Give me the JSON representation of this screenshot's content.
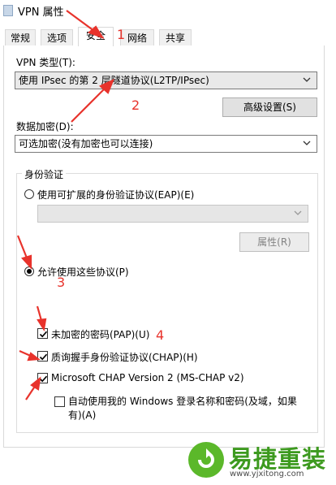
{
  "window": {
    "title": "VPN 属性"
  },
  "tabs": [
    {
      "label": "常规"
    },
    {
      "label": "选项"
    },
    {
      "label": "安全"
    },
    {
      "label": "网络"
    },
    {
      "label": "共享"
    }
  ],
  "vpn_type": {
    "label": "VPN 类型(T):",
    "value": "使用 IPsec 的第 2 层隧道协议(L2TP/IPsec)"
  },
  "advanced_button": "高级设置(S)",
  "encryption": {
    "label": "数据加密(D):",
    "value": "可选加密(没有加密也可以连接)"
  },
  "auth": {
    "title": "身份验证",
    "eap_radio": "使用可扩展的身份验证协议(EAP)(E)",
    "eap_select": "",
    "properties_button": "属性(R)",
    "allow_radio": "允许使用这些协议(P)",
    "pap": "未加密的密码(PAP)(U)",
    "chap": "质询握手身份验证协议(CHAP)(H)",
    "mschap": "Microsoft CHAP Version 2 (MS-CHAP v2)",
    "auto_login": "自动使用我的 Windows 登录名称和密码(及域，如果有)(A)",
    "states": {
      "eap_selected": false,
      "allow_selected": true,
      "pap": true,
      "chap": true,
      "mschap": true,
      "auto_login": false
    }
  },
  "annotations": {
    "n1": "1",
    "n2": "2",
    "n3": "3",
    "n4": "4"
  },
  "watermark": {
    "title": "易捷重装",
    "url": "www.yjxitong.com"
  },
  "colors": {
    "annotation_red": "#e8332c",
    "watermark_green": "#3d9a1f"
  }
}
